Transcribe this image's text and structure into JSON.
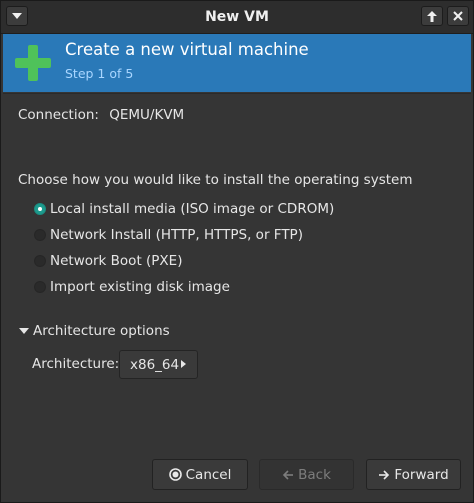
{
  "window": {
    "title": "New VM"
  },
  "banner": {
    "title": "Create a new virtual machine",
    "step": "Step 1 of 5",
    "icon": "green-plus-icon"
  },
  "connection": {
    "label": "Connection:",
    "value": "QEMU/KVM"
  },
  "install": {
    "prompt": "Choose how you would like to install the operating system",
    "options": [
      {
        "label": "Local install media (ISO image or CDROM)",
        "selected": true
      },
      {
        "label": "Network Install (HTTP, HTTPS, or FTP)",
        "selected": false
      },
      {
        "label": "Network Boot (PXE)",
        "selected": false
      },
      {
        "label": "Import existing disk image",
        "selected": false
      }
    ]
  },
  "architecture": {
    "expander_label": "Architecture options",
    "label": "Architecture:",
    "value": "x86_64"
  },
  "buttons": {
    "cancel": "Cancel",
    "back": "Back",
    "forward": "Forward"
  },
  "colors": {
    "accent": "#2a79b8",
    "radio_selected": "#1d9b8e",
    "plus_icon": "#4fc25a"
  }
}
